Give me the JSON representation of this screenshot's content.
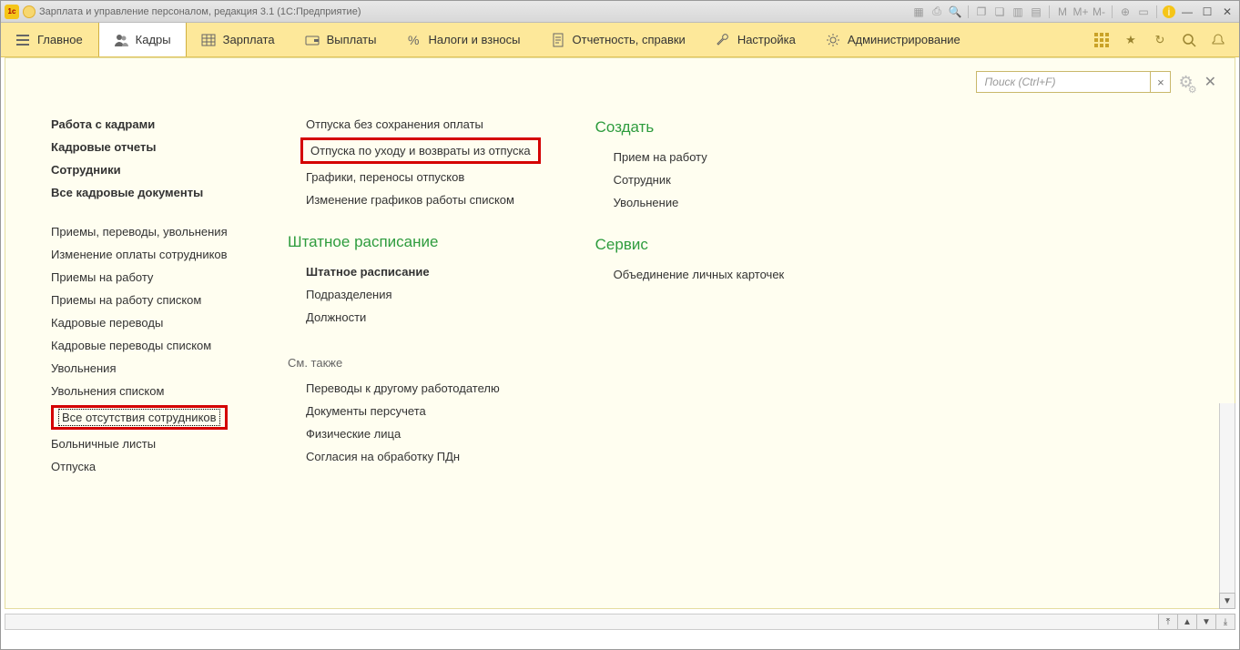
{
  "titlebar": {
    "title": "Зарплата и управление персоналом, редакция 3.1  (1С:Предприятие)"
  },
  "nav": {
    "items": [
      {
        "label": "Главное"
      },
      {
        "label": "Кадры"
      },
      {
        "label": "Зарплата"
      },
      {
        "label": "Выплаты"
      },
      {
        "label": "Налоги и взносы"
      },
      {
        "label": "Отчетность, справки"
      },
      {
        "label": "Настройка"
      },
      {
        "label": "Администрирование"
      }
    ],
    "active_index": 1
  },
  "search": {
    "placeholder": "Поиск (Ctrl+F)"
  },
  "col1": {
    "top": [
      "Работа с кадрами",
      "Кадровые отчеты",
      "Сотрудники",
      "Все кадровые документы"
    ],
    "list": [
      "Приемы, переводы, увольнения",
      "Изменение оплаты сотрудников",
      "Приемы на работу",
      "Приемы на работу списком",
      "Кадровые переводы",
      "Кадровые переводы списком",
      "Увольнения",
      "Увольнения списком",
      "Все отсутствия сотрудников",
      "Больничные листы",
      "Отпуска"
    ],
    "highlight_index": 8
  },
  "col2": {
    "top": [
      "Отпуска без сохранения оплаты",
      "Отпуска по уходу и возвраты из отпуска",
      "Графики, переносы отпусков",
      "Изменение графиков работы списком"
    ],
    "highlight_index": 1,
    "section2_title": "Штатное расписание",
    "section2_items": [
      "Штатное расписание",
      "Подразделения",
      "Должности"
    ],
    "see_also_label": "См. также",
    "see_also_items": [
      "Переводы к другому работодателю",
      "Документы персучета",
      "Физические лица",
      "Согласия на обработку ПДн"
    ]
  },
  "col3": {
    "create_title": "Создать",
    "create_items": [
      "Прием на работу",
      "Сотрудник",
      "Увольнение"
    ],
    "service_title": "Сервис",
    "service_items": [
      "Объединение личных карточек"
    ]
  }
}
